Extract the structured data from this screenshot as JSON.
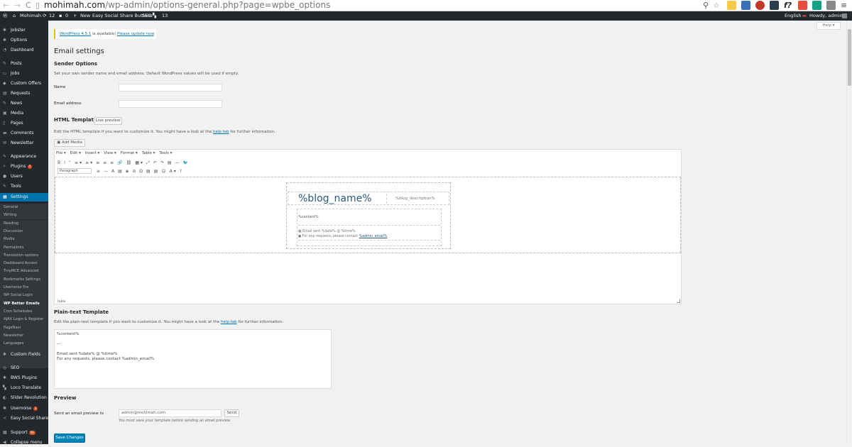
{
  "browser": {
    "url_host": "mohimah.com",
    "url_path": "/wp-admin/options-general.php?page=wpbe_options",
    "back_glyph": "←",
    "forward_glyph": "→",
    "reload_glyph": "C"
  },
  "adminbar": {
    "site_name": "Mohimah",
    "updates_count": "12",
    "comments_count": "0",
    "new_label": "New",
    "plugin_label": "Easy Social Share Buttons",
    "seo_label": "SEO",
    "extra_count": "13",
    "language": "English",
    "howdy": "Howdy, admin"
  },
  "sidebar": {
    "items": [
      {
        "label": "Jobster",
        "icon": "gear-icon"
      },
      {
        "label": "Options",
        "icon": "gear-icon"
      },
      {
        "label": "Dashboard",
        "icon": "dashboard-icon"
      },
      {
        "label": "Posts",
        "icon": "pin-icon"
      },
      {
        "label": "Jobs",
        "icon": "briefcase-icon"
      },
      {
        "label": "Custom Offers",
        "icon": "tag-icon"
      },
      {
        "label": "Requests",
        "icon": "list-icon"
      },
      {
        "label": "News",
        "icon": "pin-icon"
      },
      {
        "label": "Media",
        "icon": "media-icon"
      },
      {
        "label": "Pages",
        "icon": "page-icon"
      },
      {
        "label": "Comments",
        "icon": "comment-icon"
      },
      {
        "label": "Newsletter",
        "icon": "mail-icon"
      },
      {
        "label": "Appearance",
        "icon": "brush-icon"
      },
      {
        "label": "Plugins",
        "icon": "plug-icon",
        "badge": "7"
      },
      {
        "label": "Users",
        "icon": "user-icon"
      },
      {
        "label": "Tools",
        "icon": "wrench-icon"
      },
      {
        "label": "Settings",
        "icon": "settings-icon",
        "active": true
      }
    ],
    "submenu": [
      "General",
      "Writing",
      "Reading",
      "Discussion",
      "Media",
      "Permalinks",
      "Translation options",
      "Dashboard Access",
      "TinyMCE Advanced",
      "Bookmarks Settings",
      "Usernoise Pro",
      "WP Social Login",
      "WP Better Emails",
      "Cron Schedules",
      "AJAX Login & Register",
      "PageNavi",
      "Newsletter",
      "Languages"
    ],
    "current_submenu": "WP Better Emails",
    "lower_items": [
      {
        "label": "Custom Fields",
        "icon": "gear-icon"
      },
      {
        "label": "SEO",
        "icon": "seo-icon"
      },
      {
        "label": "BWS Plugins",
        "icon": "gear-icon"
      },
      {
        "label": "Loco Translate",
        "icon": "translate-icon"
      },
      {
        "label": "Slider Revolution",
        "icon": "slider-icon"
      },
      {
        "label": "Usernoise",
        "icon": "gear-icon",
        "badge": "3"
      },
      {
        "label": "Easy Social Share Buttons",
        "icon": "share-icon"
      },
      {
        "label": "Support",
        "icon": "support-icon",
        "badge": "56"
      },
      {
        "label": "Collapse menu",
        "icon": "collapse-icon"
      }
    ]
  },
  "help_label": "Help ▾",
  "notice": {
    "link1": "WordPress 4.5.1",
    "middle": " is available! ",
    "link2": "Please update now",
    "end": "."
  },
  "page_title": "Email settings",
  "sender": {
    "heading": "Sender Options",
    "desc": "Set your own sender name and email address. Default WordPress values will be used if empty.",
    "name_label": "Name",
    "name_value": "",
    "email_label": "Email address",
    "email_value": ""
  },
  "html_template": {
    "heading": "HTML Template",
    "live_preview": "Live preview",
    "desc_pre": "Edit the HTML template if you want to customize it. You might have a look at the ",
    "help_link": "help tab",
    "desc_post": " for further information.",
    "add_media": "Add Media",
    "menus": [
      "File ▾",
      "Edit ▾",
      "Insert ▾",
      "View ▾",
      "Format ▾",
      "Table ▾",
      "Tools ▾"
    ],
    "row1": [
      "B",
      "I",
      "“",
      "≡▾",
      "≡▾",
      "≡",
      "≡",
      "≡",
      "🔗",
      "⛓",
      "▦▾",
      "⤢",
      "↶",
      "↷",
      "▤",
      "—",
      "🐦"
    ],
    "format_value": "Paragraph",
    "row2": [
      "≡",
      "—",
      "A",
      "▤",
      "◈",
      "⊘",
      "Ω",
      "▤",
      "▤",
      "☺",
      "A▾",
      "?"
    ],
    "blog_name": "%blog_name%",
    "blog_description": "%blog_description%",
    "content_placeholder": "%content%",
    "footer_line1": "Email sent %date% @ %time%",
    "footer_line2_pre": "For any requests, please contact ",
    "footer_line2_link": "%admin_email%",
    "statusbar": "table"
  },
  "plain_template": {
    "heading": "Plain-text Template",
    "desc_pre": "Edit the plain-text template if you want to customize it. You might have a look at the ",
    "help_link": "help tab",
    "desc_post": " for further information.",
    "text": "%content%\n\n---\n\nEmail sent %date% @ %time%\nFor any requests, please contact %admin_email%"
  },
  "preview": {
    "heading": "Preview",
    "label": "Send an email preview to",
    "email_value": "admin@mohimah.com",
    "send_label": "Send",
    "note": "You must save your template before sending an email preview."
  },
  "save_label": "Save Changes",
  "colors": {
    "accent": "#0073aa",
    "adminbar": "#23282d",
    "button_primary": "#0085ba",
    "notice_border": "#ffb900"
  }
}
